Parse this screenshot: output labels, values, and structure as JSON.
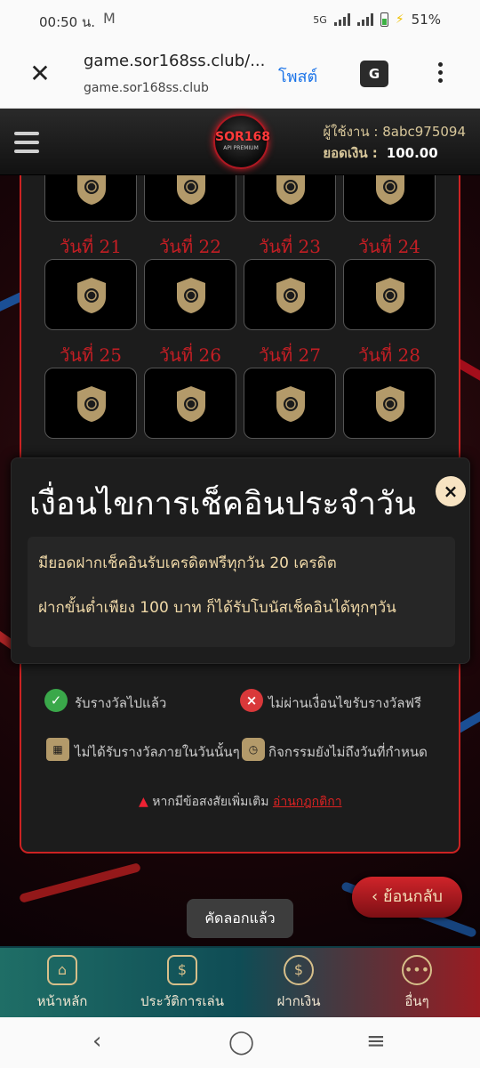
{
  "status_bar": {
    "time": "00:50 น.",
    "mail_icon": "gmail-icon",
    "network": "5G",
    "battery": "51%"
  },
  "browser": {
    "title": "game.sor168ss.club/...",
    "domain": "game.sor168ss.club",
    "post_label": "โพสต์",
    "translate_icon": "G"
  },
  "header": {
    "logo_text": "SOR168",
    "logo_sub": "API PREMIUM",
    "user_label": "ผู้ใช้งาน :",
    "username": "8abc975094",
    "balance_label": "ยอดเงิน :",
    "balance": "100.00"
  },
  "day_grid": {
    "labels_row1": [
      "วันที่ 21",
      "วันที่ 22",
      "วันที่ 23",
      "วันที่ 24"
    ],
    "labels_row2": [
      "วันที่ 25",
      "วันที่ 26",
      "วันที่ 27",
      "วันที่ 28"
    ]
  },
  "modal": {
    "title": "เงื่อนไขการเช็คอินประจำวัน",
    "close_label": "×",
    "line1": "มียอดฝากเช็คอินรับเครดิตฟรีทุกวัน 20 เครดิต",
    "line2": "ฝากขั้นต่ำเพียง 100 บาท ก็ได้รับโบนัสเช็คอินได้ทุกๆวัน"
  },
  "legend": {
    "received": "รับรางวัลไปแล้ว",
    "failed": "ไม่ผ่านเงื่อนไขรับรางวัลฟรี",
    "missed": "ไม่ได้รับรางวัลภายในวันนั้นๆ",
    "not_yet": "กิจกรรมยังไม่ถึงวันที่กำหนด"
  },
  "warning": {
    "text": "หากมีข้อสงสัยเพิ่มเติม",
    "link": "อ่านกฎกติกา"
  },
  "back_button": "ย้อนกลับ",
  "toast": "คัดลอกแล้ว",
  "bottom_nav": {
    "home": "หน้าหลัก",
    "history": "ประวัติการเล่น",
    "deposit": "ฝากเงิน",
    "more": "อื่นๆ"
  },
  "colors": {
    "accent_red": "#c41e24",
    "gold": "#d7bf8a",
    "panel": "#1c1c1c"
  }
}
